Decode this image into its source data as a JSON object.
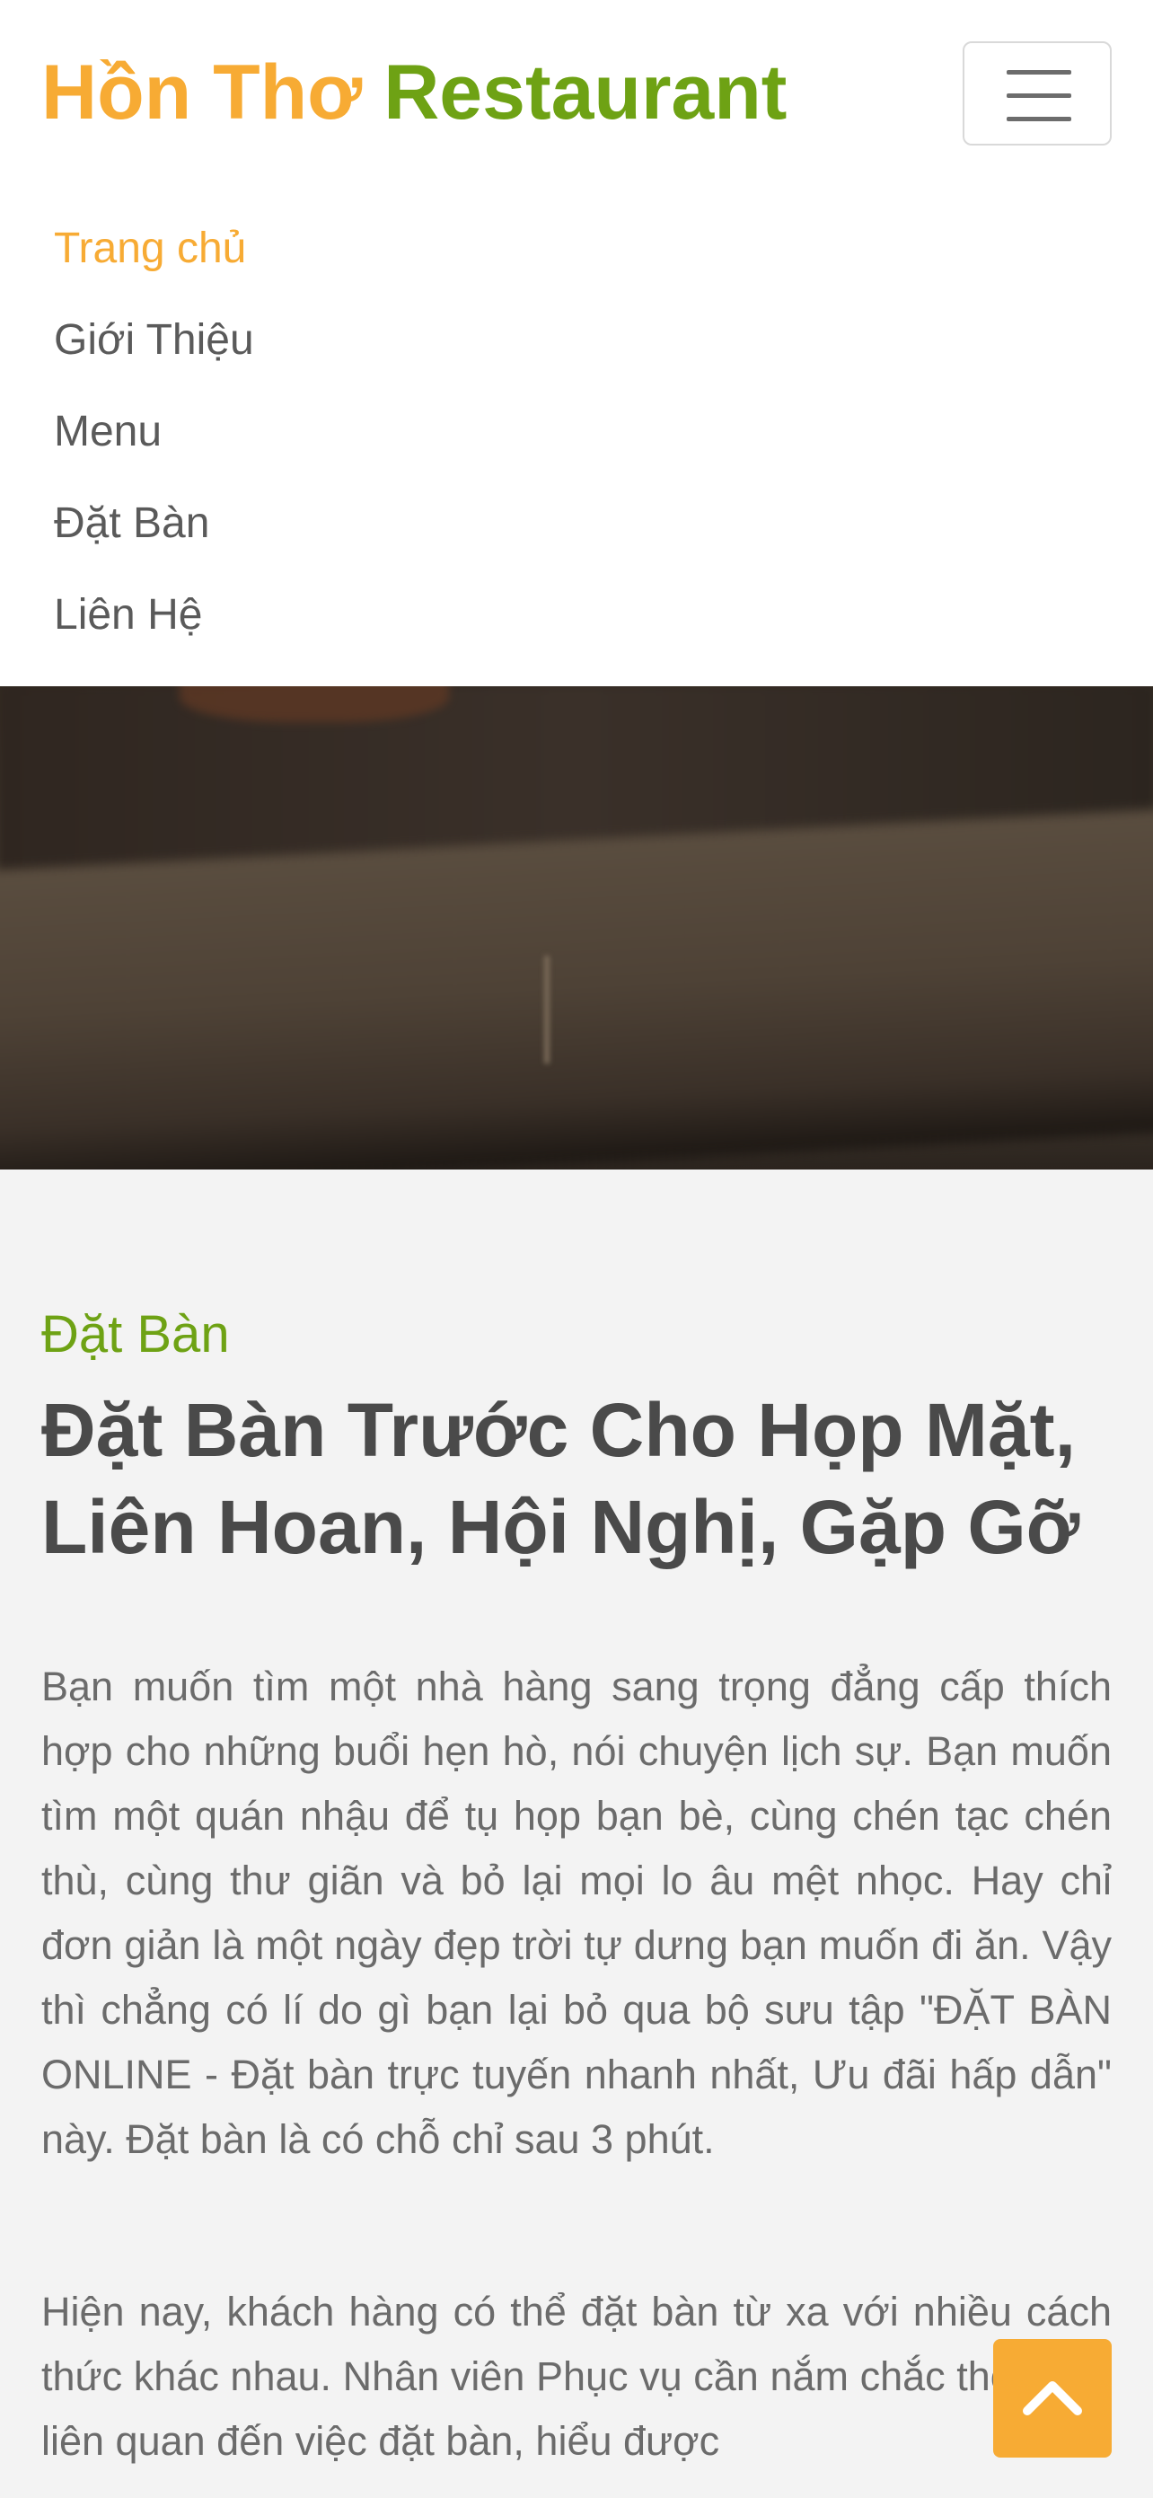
{
  "brand": {
    "part1": "Hồn Thơ",
    "part2": "Restaurant"
  },
  "nav": {
    "toggle_icon": "hamburger-menu-icon",
    "items": [
      {
        "label": "Trang chủ",
        "active": true
      },
      {
        "label": "Giới Thiệu",
        "active": false
      },
      {
        "label": "Menu",
        "active": false
      },
      {
        "label": "Đặt Bàn",
        "active": false
      },
      {
        "label": "Liên Hệ",
        "active": false
      }
    ]
  },
  "section": {
    "eyebrow": "Đặt Bàn",
    "heading": "Đặt Bàn Trước Cho Họp Mặt, Liên Hoan, Hội Nghị, Gặp Gỡ",
    "paragraphs": [
      "Bạn muốn tìm một nhà hàng sang trọng đẳng cấp thích hợp cho những buổi hẹn hò, nói chuyện lịch sự. Bạn muốn tìm một quán nhậu để tụ họp bạn bè, cùng chén tạc chén thù, cùng thư giãn và bỏ lại mọi lo âu mệt nhọc. Hay chỉ đơn giản là một ngày đẹp trời tự dưng bạn muốn đi ăn. Vậy thì chẳng có lí do gì bạn lại bỏ qua bộ sưu tập \"ĐẶT BÀN ONLINE - Đặt bàn trực tuyến nhanh nhất, Ưu đãi hấp dẫn\" này. Đặt bàn là có chỗ chỉ sau 3 phút.",
      "Hiện nay, khách hàng có thể đặt bàn từ xa với nhiều cách thức khác nhau. Nhân viên Phục vụ cần nắm chắc thông tin liên quan đến việc đặt bàn, hiểu được"
    ]
  },
  "back_to_top": {
    "icon": "chevron-up-icon"
  },
  "colors": {
    "accent_orange": "#f7ab34",
    "accent_green": "#6ea214",
    "text_dark": "#4a4a4a",
    "text_body": "#6b6b6b",
    "section_bg": "#f3f3f3"
  }
}
